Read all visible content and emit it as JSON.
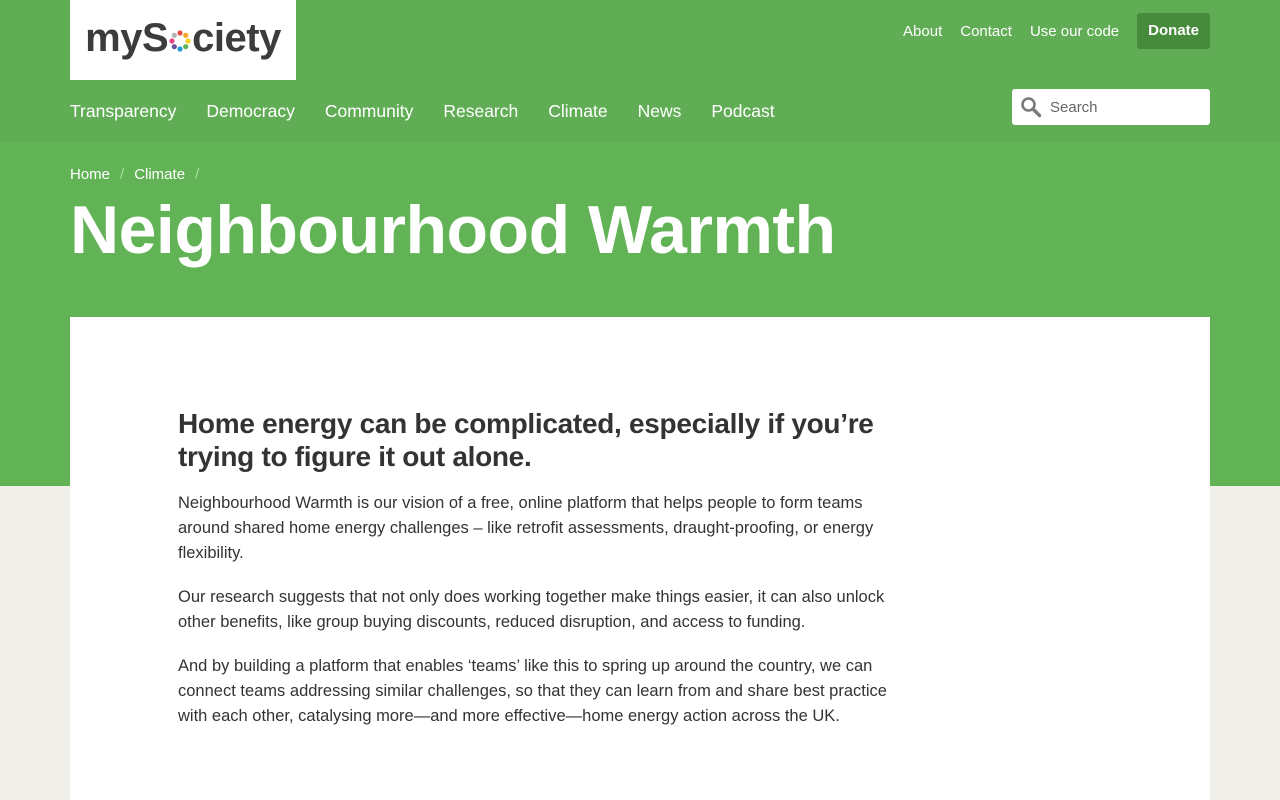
{
  "brand": {
    "logo_text_before": "myS",
    "logo_text_after": "ciety",
    "logo_dot_colors": [
      "#e54d42",
      "#f5a623",
      "#f8d21c",
      "#62b356",
      "#1f9bd7",
      "#6b4fa0",
      "#e9428b",
      "#b4b4b4"
    ]
  },
  "utility_nav": {
    "about": "About",
    "contact": "Contact",
    "use_our_code": "Use our code",
    "donate": "Donate"
  },
  "main_nav": {
    "items": [
      {
        "label": "Transparency"
      },
      {
        "label": "Democracy"
      },
      {
        "label": "Community"
      },
      {
        "label": "Research"
      },
      {
        "label": "Climate"
      },
      {
        "label": "News"
      },
      {
        "label": "Podcast"
      }
    ]
  },
  "search": {
    "placeholder": "Search",
    "icon": "search-icon"
  },
  "breadcrumb": {
    "items": [
      {
        "label": "Home"
      },
      {
        "label": "Climate"
      }
    ],
    "separator": "/"
  },
  "page": {
    "title": "Neighbourhood Warmth"
  },
  "article": {
    "lede": "Home energy can be complicated, especially if you’re trying to figure it out alone.",
    "paragraphs": [
      "Neighbourhood Warmth is our vision of a free, online platform that helps people to form teams around shared home energy challenges – like retrofit assessments, draught-proofing, or energy flexibility.",
      "Our research suggests that not only does working together make things easier, it can also unlock other benefits, like group buying discounts, reduced disruption, and access to funding.",
      "And by building a platform that enables ‘teams’ like this to spring up around the country, we can connect teams addressing similar challenges, so that they can learn from and share best practice with each other, catalysing more—and more effective—home energy action across the UK."
    ]
  },
  "colors": {
    "brand_green": "#62b356",
    "donate_green": "#468a3b",
    "page_background": "#f1efea",
    "text": "#333333"
  }
}
